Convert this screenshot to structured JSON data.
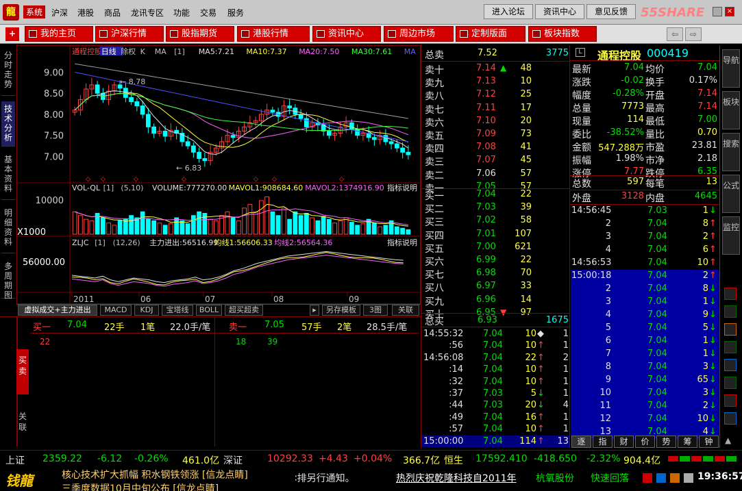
{
  "menu": {
    "items": [
      "系统",
      "沪深",
      "港股",
      "商品",
      "龙讯专区",
      "功能",
      "交易",
      "服务"
    ],
    "right_buttons": [
      "进入论坛",
      "资讯中心",
      "意见反馈"
    ],
    "watermark": "55SHARE"
  },
  "toolbar": {
    "buttons": [
      "我的主页",
      "沪深行情",
      "股指期货",
      "港股行情",
      "资讯中心",
      "周边市场",
      "定制版面",
      "板块指数"
    ]
  },
  "leftnav": [
    {
      "label": "分时走势"
    },
    {
      "label": "技术分析"
    },
    {
      "label": "基本资料"
    },
    {
      "label": "明细资料"
    },
    {
      "label": "多周期图"
    }
  ],
  "chart": {
    "header": {
      "name": "通程控股",
      "period": "日线",
      "adj": "除权",
      "type": "K",
      "ind": "MA",
      "n": "[1]",
      "ma5": "MA5:7.21",
      "ma10": "MA10:7.37",
      "ma20": "MA20:7.50",
      "ma30": "MA30:7.61",
      "ma": "MA"
    },
    "yaxis": [
      "9.00",
      "8.50",
      "8.00",
      "7.50",
      "7.00"
    ],
    "hi_label": "8.78",
    "lo_label": "6.83",
    "vol_header": {
      "name": "VOL-QL",
      "n": "[1]",
      "p": "(5,10)",
      "volume": "VOLUME:777270.00",
      "mavol1": "MAVOL1:908684.60",
      "mavol2": "MAVOL2:1374916.90",
      "tip": "指标说明"
    },
    "vol_yaxis": [
      "10000",
      "X1000"
    ],
    "zljc_header": {
      "name": "ZLJC",
      "n": "[1]",
      "p": "(12,26)",
      "zl": "主力进出:56516.99",
      "j1": "均线1:56606.33",
      "j2": "均线2:56564.36",
      "tip": "指标说明"
    },
    "zljc_yaxis": "56000.00",
    "xaxis": [
      "2011",
      "06",
      "07",
      "08",
      "09"
    ]
  },
  "chart_data": {
    "type": "candlestick",
    "title": "通程控股 日线",
    "ylim": [
      6.6,
      9.3
    ],
    "ma": {
      "MA5": 7.21,
      "MA10": 7.37,
      "MA20": 7.5,
      "MA30": 7.61
    },
    "high": 8.78,
    "low": 6.83,
    "x_ticks": [
      "2011",
      "06",
      "07",
      "08",
      "09"
    ],
    "close": [
      8.1,
      8.35,
      8.6,
      8.7,
      8.5,
      8.35,
      8.55,
      8.7,
      8.62,
      8.4,
      8.3,
      8.2,
      8.0,
      7.7,
      7.55,
      7.6,
      7.48,
      7.62,
      7.55,
      7.35,
      7.25,
      7.1,
      6.95,
      6.9,
      7.1,
      7.2,
      7.35,
      7.5,
      7.45,
      7.6,
      7.7,
      7.8,
      7.85,
      8.0,
      8.1,
      8.05,
      7.95,
      8.2,
      8.15,
      8.0,
      7.9,
      7.7,
      7.8,
      7.75,
      7.6,
      7.5,
      7.55,
      7.7,
      7.8,
      7.65,
      7.5,
      7.55,
      7.45,
      7.4,
      7.5,
      7.35,
      7.3,
      7.2,
      7.1,
      7.04
    ],
    "volume": [
      30,
      25,
      20,
      18,
      28,
      22,
      15,
      12,
      18,
      20,
      25,
      22,
      30,
      20,
      18,
      15,
      12,
      14,
      22,
      18,
      14,
      25,
      30,
      28,
      20,
      18,
      25,
      30,
      22,
      18,
      35,
      40,
      30,
      45,
      50,
      30,
      25,
      35,
      20,
      30,
      25,
      28,
      22,
      18,
      24,
      20,
      15,
      18,
      22,
      16,
      12,
      14,
      20,
      15,
      10,
      12,
      18,
      10,
      8,
      6
    ],
    "zljc": [
      56350,
      56340,
      56330,
      56320,
      56340,
      56300,
      56280,
      56300,
      56320,
      56310,
      56300,
      56280,
      56270,
      56290,
      56300,
      56310,
      56330,
      56300,
      56310,
      56330,
      56360,
      56400,
      56420,
      56450,
      56480,
      56500,
      56520,
      56540,
      56560,
      56570,
      56580,
      56590,
      56600,
      56610,
      56600,
      56590,
      56580,
      56570,
      56560,
      56550,
      56540,
      56530,
      56520,
      56515
    ]
  },
  "chart_tabs": [
    "虚拟成交+主力进出",
    "MACD",
    "KDJ",
    "宝塔线",
    "BOLL",
    "超买超卖",
    "另存模板",
    "3图",
    "关联"
  ],
  "bottom": {
    "buy": {
      "label": "买一",
      "price": "7.04",
      "lots": "22手",
      "orders": "1笔",
      "avg": "22.0手/笔",
      "queue": [
        "22"
      ]
    },
    "sell": {
      "label": "卖一",
      "price": "7.05",
      "lots": "57手",
      "orders": "2笔",
      "avg": "28.5手/笔",
      "queue": [
        "18",
        "39"
      ]
    },
    "side_tabs": [
      "买卖",
      "关联"
    ]
  },
  "orderbook": {
    "sell_total": {
      "label": "总卖",
      "price": "7.52",
      "vol": "3775"
    },
    "asks": [
      {
        "l": "卖十",
        "p": "7.14",
        "v": "48",
        "c": "red",
        "arrow": "up"
      },
      {
        "l": "卖九",
        "p": "7.13",
        "v": "10",
        "c": "red"
      },
      {
        "l": "卖八",
        "p": "7.12",
        "v": "25",
        "c": "red"
      },
      {
        "l": "卖七",
        "p": "7.11",
        "v": "17",
        "c": "red"
      },
      {
        "l": "卖六",
        "p": "7.10",
        "v": "20",
        "c": "red"
      },
      {
        "l": "卖五",
        "p": "7.09",
        "v": "73",
        "c": "red"
      },
      {
        "l": "卖四",
        "p": "7.08",
        "v": "41",
        "c": "red"
      },
      {
        "l": "卖三",
        "p": "7.07",
        "v": "45",
        "c": "red"
      },
      {
        "l": "卖二",
        "p": "7.06",
        "v": "57",
        "c": "wht"
      },
      {
        "l": "卖一",
        "p": "7.05",
        "v": "57",
        "c": "grn"
      }
    ],
    "bids": [
      {
        "l": "买一",
        "p": "7.04",
        "v": "22",
        "c": "grn"
      },
      {
        "l": "买二",
        "p": "7.03",
        "v": "39",
        "c": "grn"
      },
      {
        "l": "买三",
        "p": "7.02",
        "v": "58",
        "c": "grn"
      },
      {
        "l": "买四",
        "p": "7.01",
        "v": "107",
        "c": "grn"
      },
      {
        "l": "买五",
        "p": "7.00",
        "v": "621",
        "c": "grn"
      },
      {
        "l": "买六",
        "p": "6.99",
        "v": "22",
        "c": "grn"
      },
      {
        "l": "买七",
        "p": "6.98",
        "v": "70",
        "c": "grn"
      },
      {
        "l": "买八",
        "p": "6.97",
        "v": "33",
        "c": "grn"
      },
      {
        "l": "买九",
        "p": "6.96",
        "v": "14",
        "c": "grn"
      },
      {
        "l": "买十",
        "p": "6.95",
        "v": "97",
        "c": "grn",
        "arrow": "down"
      }
    ],
    "buy_total": {
      "label": "总买",
      "price": "6.93",
      "vol": "1675"
    },
    "ticks": [
      {
        "t": "14:55:32",
        "p": "7.04",
        "v": "10",
        "a": "◆",
        "n": "1",
        "ac": "wht"
      },
      {
        "t": ":56",
        "p": "7.04",
        "v": "10",
        "a": "↑",
        "n": "1",
        "ac": "red"
      },
      {
        "t": "14:56:08",
        "p": "7.04",
        "v": "22",
        "a": "↑",
        "n": "2",
        "ac": "red"
      },
      {
        "t": ":14",
        "p": "7.04",
        "v": "10",
        "a": "↑",
        "n": "1",
        "ac": "red"
      },
      {
        "t": ":32",
        "p": "7.04",
        "v": "10",
        "a": "↑",
        "n": "1",
        "ac": "red"
      },
      {
        "t": ":37",
        "p": "7.03",
        "v": "5",
        "a": "↓",
        "n": "1",
        "ac": "grn"
      },
      {
        "t": ":44",
        "p": "7.03",
        "v": "20",
        "a": "↓",
        "n": "4",
        "ac": "grn"
      },
      {
        "t": ":49",
        "p": "7.04",
        "v": "16",
        "a": "↑",
        "n": "1",
        "ac": "red"
      },
      {
        "t": ":57",
        "p": "7.04",
        "v": "10",
        "a": "↑",
        "n": "1",
        "ac": "red"
      },
      {
        "t": "15:00:00",
        "p": "7.04",
        "v": "114",
        "a": "↑",
        "n": "13",
        "ac": "red"
      }
    ]
  },
  "quote": {
    "name": "通程控股",
    "code": "000419",
    "rows": [
      [
        "最新",
        "7.04",
        "均价",
        "7.04"
      ],
      [
        "涨跌",
        "-0.02",
        "换手",
        "0.17%"
      ],
      [
        "幅度",
        "-0.28%",
        "开盘",
        "7.14"
      ],
      [
        "总量",
        "7773",
        "最高",
        "7.14"
      ],
      [
        "现量",
        "114",
        "最低",
        "7.00"
      ],
      [
        "委比",
        "-38.52%",
        "量比",
        "0.70"
      ],
      [
        "金额",
        "547.288万",
        "市盈",
        "23.81"
      ],
      [
        "振幅",
        "1.98%",
        "市净",
        "2.18"
      ],
      [
        "涨停",
        "7.77",
        "跌停",
        "6.35"
      ]
    ],
    "row_colors": [
      [
        "grn",
        "grn"
      ],
      [
        "grn",
        "wht"
      ],
      [
        "grn",
        "red"
      ],
      [
        "yel",
        "red"
      ],
      [
        "yel",
        "grn"
      ],
      [
        "grn",
        "yel"
      ],
      [
        "yel",
        "wht"
      ],
      [
        "wht",
        "wht"
      ],
      [
        "red",
        "grn"
      ]
    ],
    "totals": {
      "l1": "总数",
      "v1": "597",
      "l2": "每笔",
      "v2": "13"
    },
    "outin": {
      "l1": "外盘",
      "v1": "3128",
      "l2": "内盘",
      "v2": "4645"
    },
    "ticks": [
      {
        "t": "14:56:45",
        "p": "7.03",
        "v": "1",
        "a": "↓",
        "ac": "grn"
      },
      {
        "t": "2",
        "p": "7.04",
        "v": "8",
        "a": "↑",
        "ac": "red"
      },
      {
        "t": "3",
        "p": "7.04",
        "v": "2",
        "a": "↑",
        "ac": "red"
      },
      {
        "t": "4",
        "p": "7.04",
        "v": "6",
        "a": "↑",
        "ac": "red"
      },
      {
        "t": "14:56:53",
        "p": "7.04",
        "v": "10",
        "a": "↑",
        "ac": "red"
      },
      {
        "t": "15:00:18",
        "p": "7.04",
        "v": "2",
        "a": "↑",
        "ac": "red",
        "hl": true
      },
      {
        "t": "2",
        "p": "7.04",
        "v": "8",
        "a": "↓",
        "ac": "grn",
        "hl": true
      },
      {
        "t": "3",
        "p": "7.04",
        "v": "1",
        "a": "↓",
        "ac": "grn",
        "hl": true
      },
      {
        "t": "4",
        "p": "7.04",
        "v": "9",
        "a": "↓",
        "ac": "grn",
        "hl": true
      },
      {
        "t": "5",
        "p": "7.04",
        "v": "5",
        "a": "↓",
        "ac": "grn",
        "hl": true
      },
      {
        "t": "6",
        "p": "7.04",
        "v": "1",
        "a": "↓",
        "ac": "grn",
        "hl": true
      },
      {
        "t": "7",
        "p": "7.04",
        "v": "1",
        "a": "↓",
        "ac": "grn",
        "hl": true
      },
      {
        "t": "8",
        "p": "7.04",
        "v": "3",
        "a": "↓",
        "ac": "grn",
        "hl": true
      },
      {
        "t": "9",
        "p": "7.04",
        "v": "65",
        "a": "↓",
        "ac": "grn",
        "hl": true
      },
      {
        "t": "10",
        "p": "7.04",
        "v": "3",
        "a": "↓",
        "ac": "grn",
        "hl": true
      },
      {
        "t": "11",
        "p": "7.04",
        "v": "2",
        "a": "↓",
        "ac": "grn",
        "hl": true
      },
      {
        "t": "12",
        "p": "7.04",
        "v": "10",
        "a": "↓",
        "ac": "grn",
        "hl": true
      },
      {
        "t": "13",
        "p": "7.04",
        "v": "4",
        "a": "↓",
        "ac": "grn",
        "hl": true
      }
    ],
    "tabs": [
      "逐",
      "指",
      "财",
      "价",
      "势",
      "筹",
      "钟"
    ]
  },
  "rightnav": [
    "导航",
    "板块",
    "搜索",
    "公式",
    "监控"
  ],
  "statusbar": {
    "sh_label": "上证",
    "sh_val": "2359.22",
    "sh_chg": "-6.12",
    "sh_pct": "-0.26%",
    "sh_amt": "461.0亿",
    "sz_label": "深证",
    "sz_val": "10292.33",
    "sz_chg": "+4.43",
    "sz_pct": "+0.04%",
    "sz_amt": "366.7亿",
    "hs_label": "恒生",
    "hs_val": "17592.410",
    "hs_chg": "-418.650",
    "hs_pct": "-2.32%",
    "hs_amt": "904.4亿"
  },
  "footer": {
    "news1": "核心技术扩大抓幅 积水钢铁领涨 [信龙点睛]",
    "news2": "三季度数据10月中旬公布 [信龙点睛]",
    "scroll": "排另行通知。",
    "headline": "热烈庆祝乾隆科技自2011年",
    "stock1": "杭氧股份",
    "stock2": "快速回落",
    "time": "19:36:57"
  }
}
